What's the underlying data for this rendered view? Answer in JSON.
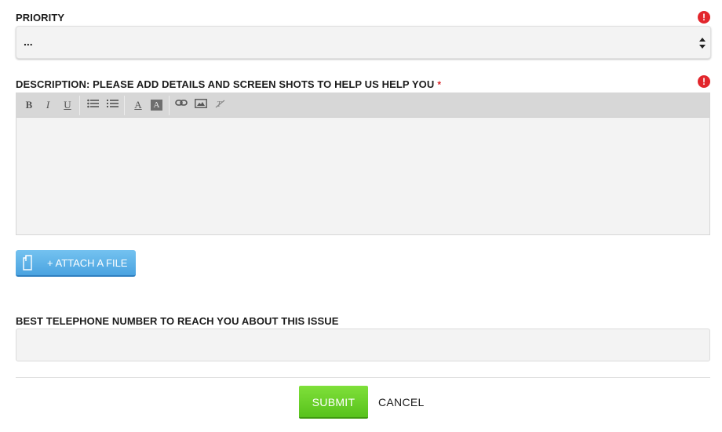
{
  "priority": {
    "label": "PRIORITY",
    "selected_value": "...",
    "error_icon": "exclamation-circle-icon",
    "error_color": "#e2262c"
  },
  "description": {
    "label": "DESCRIPTION: PLEASE ADD DETAILS AND SCREEN SHOTS TO HELP US HELP YOU",
    "required_marker": "*",
    "error_icon": "exclamation-circle-icon",
    "value": "",
    "toolbar": {
      "bold": "B",
      "italic": "I",
      "underline": "U",
      "text_color": "A",
      "bg_color": "A",
      "icons": [
        "bold-icon",
        "italic-icon",
        "underline-icon",
        "bulleted-list-icon",
        "numbered-list-icon",
        "text-color-icon",
        "background-color-icon",
        "link-icon",
        "image-icon",
        "remove-format-icon"
      ]
    }
  },
  "attach": {
    "label": "+ ATTACH A FILE",
    "icon": "file-icon",
    "color": "#4aa3e0"
  },
  "phone": {
    "label": "BEST TELEPHONE NUMBER TO REACH YOU ABOUT THIS ISSUE",
    "value": ""
  },
  "actions": {
    "submit_label": "SUBMIT",
    "cancel_label": "CANCEL",
    "submit_color": "#58c21c"
  }
}
